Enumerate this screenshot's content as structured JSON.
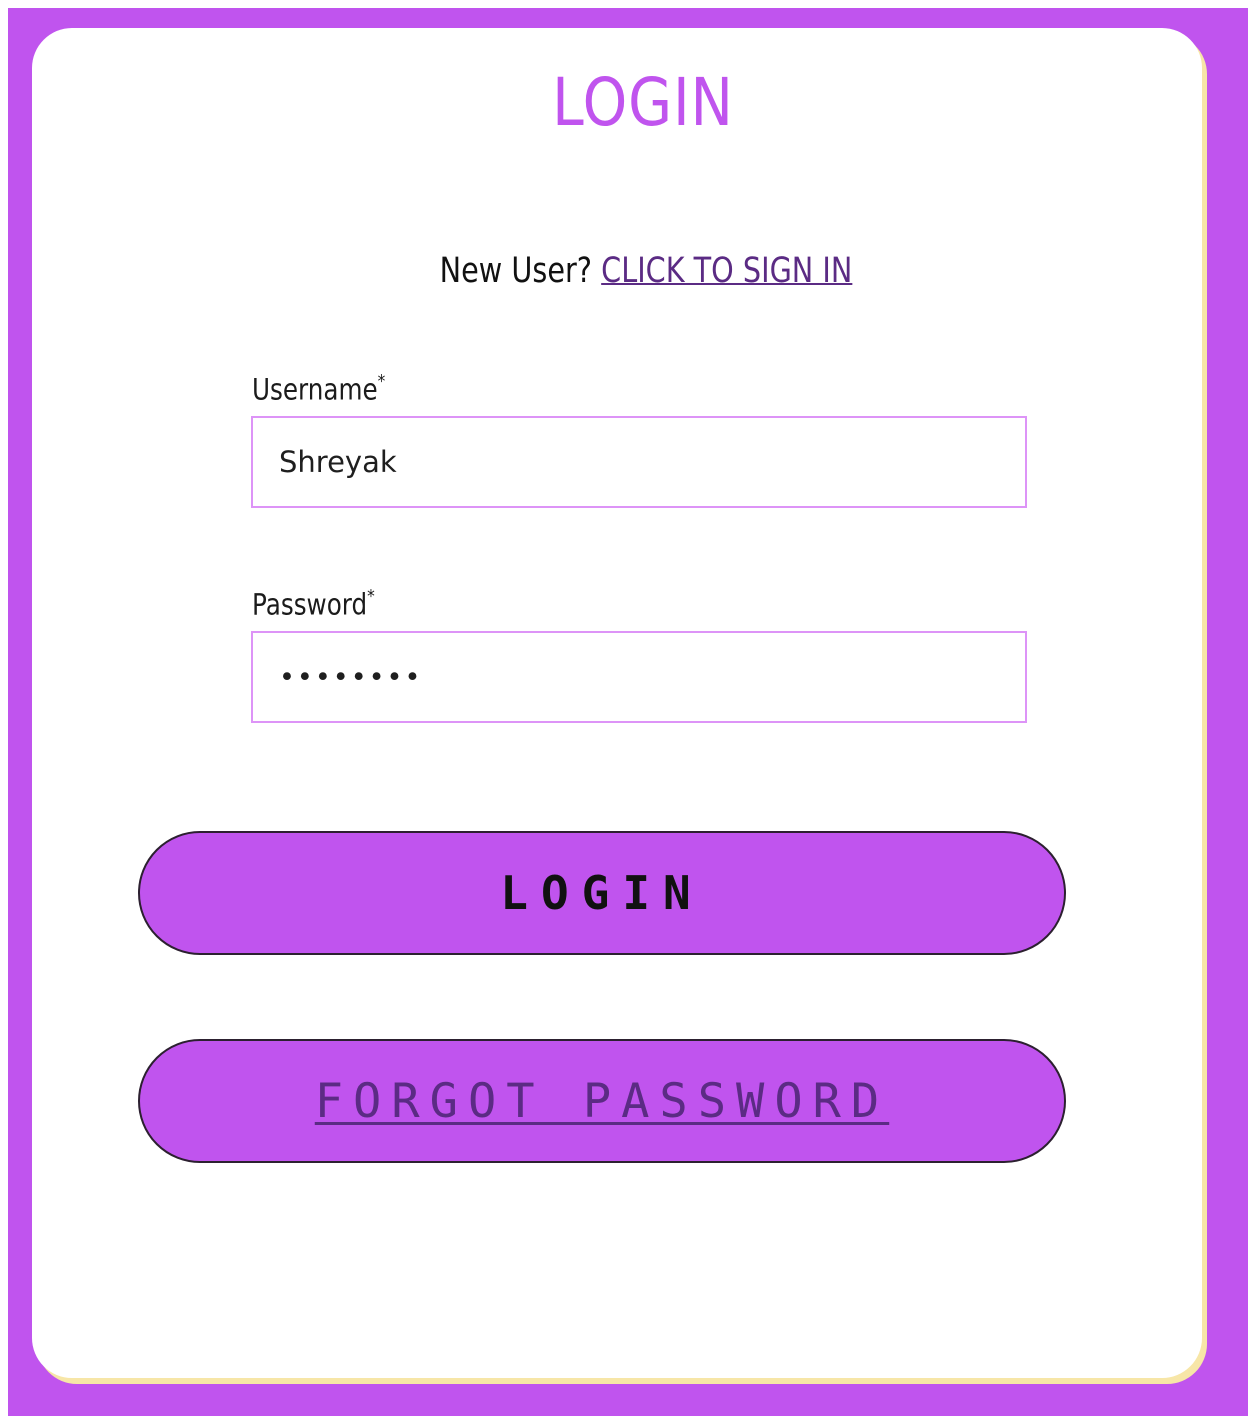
{
  "colors": {
    "accent": "#c054ee",
    "card_background": "#ffffff",
    "input_border": "#dd94f7",
    "link": "#5b2b84",
    "text": "#111111",
    "shadow": "#f7e6a7"
  },
  "login_form": {
    "title": "LOGIN",
    "new_user_prompt": "New User?",
    "sign_in_link": "CLICK TO SIGN IN",
    "username": {
      "label": "Username",
      "required_marker": "*",
      "value": "Shreyak"
    },
    "password": {
      "label": "Password",
      "required_marker": "*",
      "value": "••••••••"
    },
    "login_button": "LOGIN",
    "forgot_password": "FORGOT PASSWORD"
  }
}
